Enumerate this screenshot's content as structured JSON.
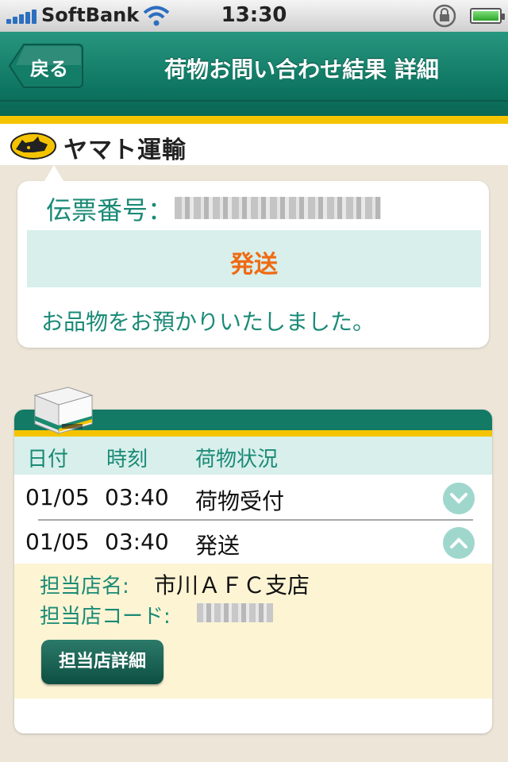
{
  "status_bar": {
    "carrier": "SoftBank",
    "time": "13:30"
  },
  "nav": {
    "back_label": "戻る",
    "title": "荷物お問い合わせ結果 詳細"
  },
  "brand": {
    "name": "ヤマト運輸"
  },
  "slip": {
    "label": "伝票番号：",
    "status": "発送",
    "message": "お品物をお預かりいたしました。"
  },
  "history": {
    "headers": {
      "date": "日付",
      "time": "時刻",
      "status": "荷物状況"
    },
    "rows": [
      {
        "date": "01/05",
        "time": "03:40",
        "status": "荷物受付",
        "toggle": "chevron-down-icon"
      },
      {
        "date": "01/05",
        "time": "03:40",
        "status": "発送",
        "toggle": "chevron-up-icon"
      }
    ],
    "detail": {
      "store_name_label": "担当店名:",
      "store_name": "市川ＡＦＣ支店",
      "store_code_label": "担当店コード:",
      "button_label": "担当店詳細"
    }
  },
  "colors": {
    "accent_green": "#0d7460",
    "brand_yellow": "#f5c400",
    "status_orange": "#ef6a12",
    "text_teal": "#1a8a76"
  }
}
